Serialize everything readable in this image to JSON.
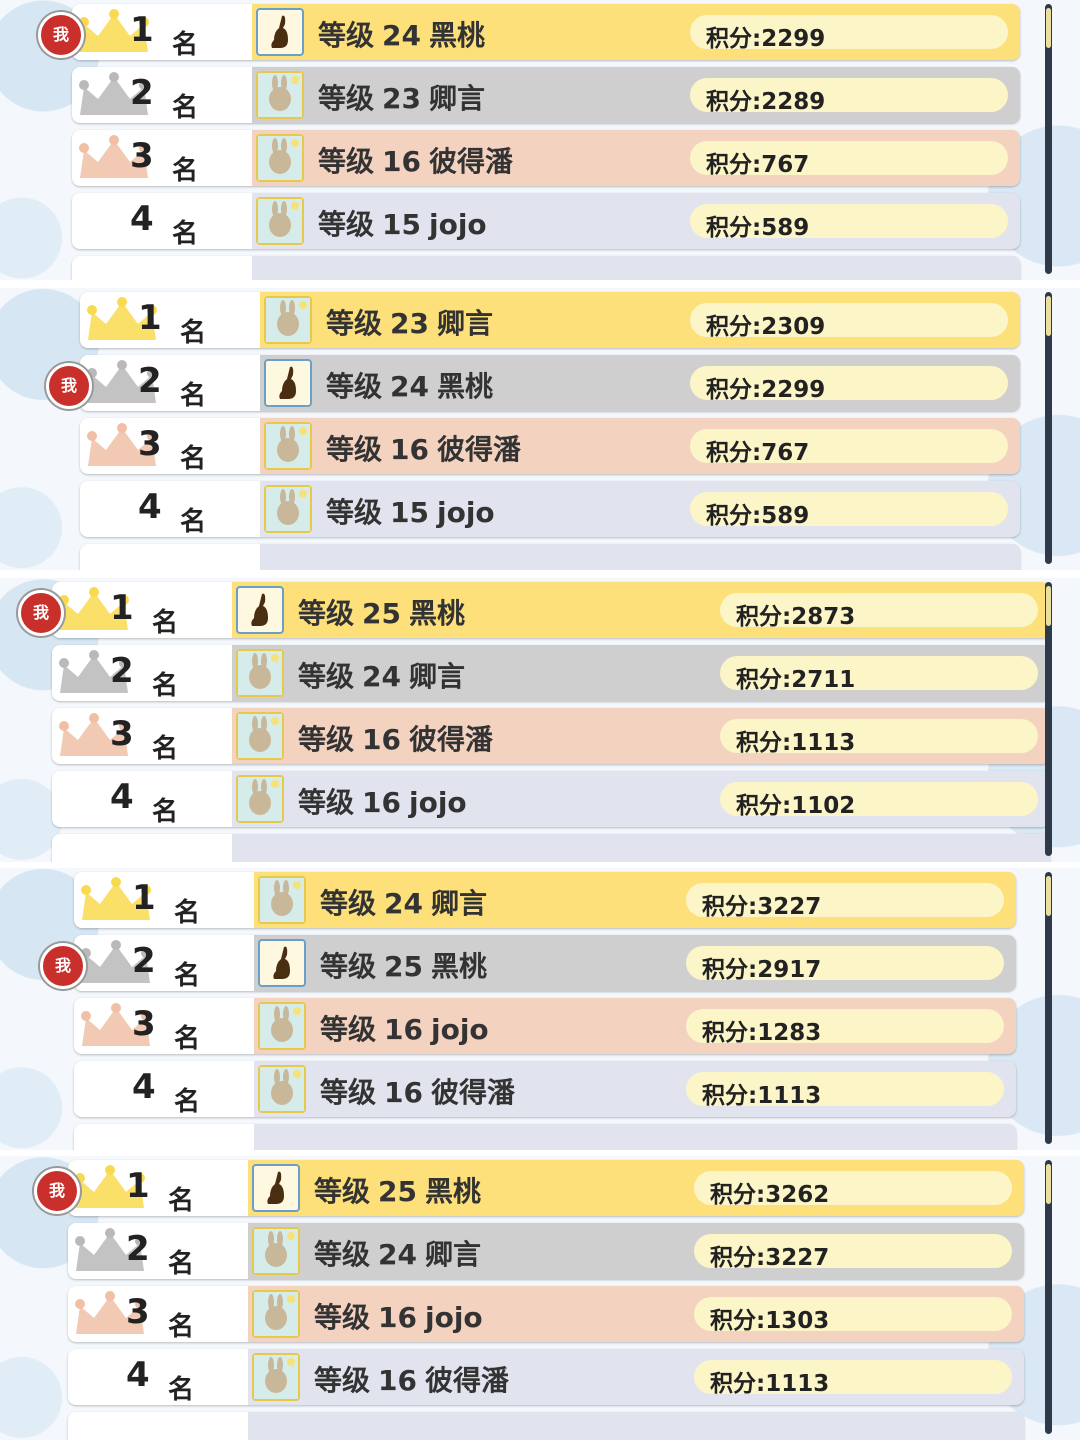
{
  "rank_suffix": "名",
  "score_prefix": "积分:",
  "level_prefix": "等级",
  "me_badge": "我",
  "colors": {
    "rank1": "#fde07a",
    "rank2": "#cfcfcf",
    "rank3": "#f3d2c0",
    "rank_other": "#e1e4ee",
    "score_pill": "#fcf5c8",
    "me_badge": "#c9302c"
  },
  "panels": [
    {
      "rows": [
        {
          "rank": "1",
          "level": "24",
          "name": "黑桃",
          "score": "2299",
          "me": true,
          "avatar": "bunny-silhouette-icon"
        },
        {
          "rank": "2",
          "level": "23",
          "name": "卿言",
          "score": "2289",
          "me": false,
          "avatar": "rabbit-portrait-icon"
        },
        {
          "rank": "3",
          "level": "16",
          "name": "彼得潘",
          "score": "767",
          "me": false,
          "avatar": "rabbit-portrait-icon"
        },
        {
          "rank": "4",
          "level": "15",
          "name": "jojo",
          "score": "589",
          "me": false,
          "avatar": "rabbit-portrait-icon"
        }
      ]
    },
    {
      "rows": [
        {
          "rank": "1",
          "level": "23",
          "name": "卿言",
          "score": "2309",
          "me": false,
          "avatar": "rabbit-portrait-icon"
        },
        {
          "rank": "2",
          "level": "24",
          "name": "黑桃",
          "score": "2299",
          "me": true,
          "avatar": "bunny-silhouette-icon"
        },
        {
          "rank": "3",
          "level": "16",
          "name": "彼得潘",
          "score": "767",
          "me": false,
          "avatar": "rabbit-portrait-icon"
        },
        {
          "rank": "4",
          "level": "15",
          "name": "jojo",
          "score": "589",
          "me": false,
          "avatar": "rabbit-portrait-icon"
        }
      ]
    },
    {
      "rows": [
        {
          "rank": "1",
          "level": "25",
          "name": "黑桃",
          "score": "2873",
          "me": true,
          "avatar": "bunny-silhouette-icon"
        },
        {
          "rank": "2",
          "level": "24",
          "name": "卿言",
          "score": "2711",
          "me": false,
          "avatar": "rabbit-portrait-icon"
        },
        {
          "rank": "3",
          "level": "16",
          "name": "彼得潘",
          "score": "1113",
          "me": false,
          "avatar": "rabbit-portrait-icon"
        },
        {
          "rank": "4",
          "level": "16",
          "name": "jojo",
          "score": "1102",
          "me": false,
          "avatar": "rabbit-portrait-icon"
        }
      ]
    },
    {
      "rows": [
        {
          "rank": "1",
          "level": "24",
          "name": "卿言",
          "score": "3227",
          "me": false,
          "avatar": "rabbit-portrait-icon"
        },
        {
          "rank": "2",
          "level": "25",
          "name": "黑桃",
          "score": "2917",
          "me": true,
          "avatar": "bunny-silhouette-icon"
        },
        {
          "rank": "3",
          "level": "16",
          "name": "jojo",
          "score": "1283",
          "me": false,
          "avatar": "rabbit-portrait-icon"
        },
        {
          "rank": "4",
          "level": "16",
          "name": "彼得潘",
          "score": "1113",
          "me": false,
          "avatar": "rabbit-portrait-icon"
        }
      ]
    },
    {
      "rows": [
        {
          "rank": "1",
          "level": "25",
          "name": "黑桃",
          "score": "3262",
          "me": true,
          "avatar": "bunny-silhouette-icon"
        },
        {
          "rank": "2",
          "level": "24",
          "name": "卿言",
          "score": "3227",
          "me": false,
          "avatar": "rabbit-portrait-icon"
        },
        {
          "rank": "3",
          "level": "16",
          "name": "jojo",
          "score": "1303",
          "me": false,
          "avatar": "rabbit-portrait-icon"
        },
        {
          "rank": "4",
          "level": "16",
          "name": "彼得潘",
          "score": "1113",
          "me": false,
          "avatar": "rabbit-portrait-icon"
        }
      ]
    }
  ]
}
